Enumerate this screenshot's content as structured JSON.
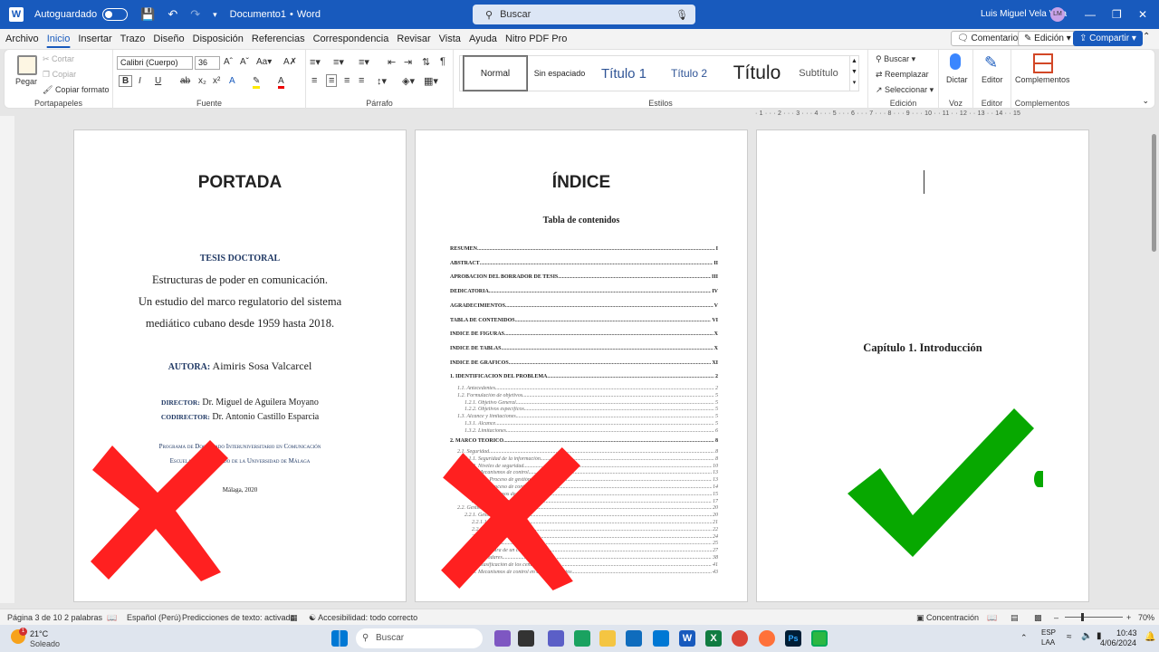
{
  "titlebar": {
    "autosave_label": "Autoguardado",
    "doc_name": "Documento1",
    "separator": "•",
    "app_name": "Word",
    "search_placeholder": "Buscar",
    "user_name": "Luis Miguel Vela Vela",
    "user_initials": "LM"
  },
  "menu": {
    "tabs": [
      "Archivo",
      "Inicio",
      "Insertar",
      "Trazo",
      "Diseño",
      "Disposición",
      "Referencias",
      "Correspondencia",
      "Revisar",
      "Vista",
      "Ayuda",
      "Nitro PDF Pro"
    ],
    "active_tab": "Inicio",
    "comments_label": "Comentarios",
    "edit_label": "Edición",
    "share_label": "Compartir"
  },
  "ribbon": {
    "clipboard": {
      "paste": "Pegar",
      "cut": "Cortar",
      "copy": "Copiar",
      "format_painter": "Copiar formato",
      "label": "Portapapeles"
    },
    "font": {
      "name": "Calibri (Cuerpo)",
      "size": "36",
      "label": "Fuente"
    },
    "paragraph": {
      "label": "Párrafo"
    },
    "styles": {
      "items": [
        "Normal",
        "Sin espaciado",
        "Título 1",
        "Título 2",
        "Título",
        "Subtítulo"
      ],
      "label": "Estilos"
    },
    "editing": {
      "find": "Buscar",
      "replace": "Reemplazar",
      "select": "Seleccionar",
      "label": "Edición"
    },
    "voice": {
      "dictate": "Dictar",
      "label": "Voz"
    },
    "editor": {
      "button": "Editor",
      "label": "Editor"
    },
    "addins": {
      "button": "Complementos",
      "label": "Complementos"
    }
  },
  "ruler_text": "· 1 · · · 2 · · · 3 · · · 4 · · · 5 · · · 6 · · · 7 · · · 8 · · · 9 · · · 10 · · 11 · · 12 · · 13 · · 14 · · 15",
  "page1": {
    "heading": "PORTADA",
    "label": "TESIS DOCTORAL",
    "line1": "Estructuras de poder en comunicación.",
    "line2": "Un estudio del marco regulatorio del sistema",
    "line3": "mediático cubano desde 1959 hasta 2018.",
    "author_label": "AUTORA:",
    "author": "Aimiris Sosa Valcarcel",
    "director_label": "DIRECTOR:",
    "director": "Dr. Miguel de Aguilera Moyano",
    "codirector_label": "CODIRECTOR:",
    "codirector": "Dr. Antonio Castillo Esparcia",
    "program": "Programa de Doctorado Interuniversitario en Comunicación",
    "school": "Escuela de Doctorado de la Universidad de Málaga",
    "place_date": "Málaga, 2020"
  },
  "page2": {
    "heading": "ÍNDICE",
    "subtitle": "Tabla de contenidos",
    "toc": [
      {
        "t": "RESUMEN",
        "p": "I"
      },
      {
        "t": "ABSTRACT",
        "p": "II"
      },
      {
        "t": "APROBACIÓN DEL BORRADOR DE TESIS",
        "p": "III"
      },
      {
        "t": "DEDICATORIA",
        "p": "IV"
      },
      {
        "t": "AGRADECIMIENTOS",
        "p": "V"
      },
      {
        "t": "TABLA DE CONTENIDOS",
        "p": "VI"
      },
      {
        "t": "ÍNDICE DE FIGURAS",
        "p": "X"
      },
      {
        "t": "ÍNDICE DE TABLAS",
        "p": "X"
      },
      {
        "t": "ÍNDICE DE GRÁFICOS",
        "p": "XI"
      },
      {
        "t": "1.    IDENTIFICACIÓN DEL PROBLEMA",
        "p": "2"
      }
    ],
    "toc_sub1": [
      {
        "t": "1.1.    Antecedentes",
        "p": "2"
      },
      {
        "t": "1.2.    Formulación de objetivos",
        "p": "5"
      },
      {
        "t": "1.2.1.    Objetivo General",
        "p": "5"
      },
      {
        "t": "1.2.2.    Objetivos específicos",
        "p": "5"
      },
      {
        "t": "1.3.    Alcance y limitaciones",
        "p": "5"
      },
      {
        "t": "1.3.1.    Alcance",
        "p": "5"
      },
      {
        "t": "1.3.2.    Limitaciones",
        "p": "6"
      }
    ],
    "toc_main2": {
      "t": "2.    MARCO TEÓRICO",
      "p": "8"
    },
    "toc_sub2": [
      {
        "t": "2.1.    Seguridad",
        "p": "8"
      },
      {
        "t": "2.1.1.    Seguridad de la información",
        "p": "8"
      },
      {
        "t": "2.1.2.    Niveles de seguridad",
        "p": "10"
      },
      {
        "t": "2.1.3.    Mecanismos de control",
        "p": "13"
      },
      {
        "t": "2.1.3.1.    Proceso de gestión",
        "p": "13"
      },
      {
        "t": "2.1.3.2.    Proceso de control",
        "p": "14"
      },
      {
        "t": "2.1.3.3.    Procesos de revisión",
        "p": "15"
      },
      {
        "t": "2.1.3.4.    Procesos",
        "p": "17"
      },
      {
        "t": "2.2.    Gestión de la información",
        "p": "20"
      },
      {
        "t": "2.2.1.    Gestión",
        "p": "20"
      },
      {
        "t": "2.2.1.1.    Etapas",
        "p": "21"
      },
      {
        "t": "2.2.1.2.    Recursos",
        "p": "22"
      },
      {
        "t": "2.2.1.3.    Registro en tiempo",
        "p": "24"
      },
      {
        "t": "2.2.1.4.    Datos",
        "p": "25"
      },
      {
        "t": "2.2.2.    Estructura de un centro de datos",
        "p": "27"
      },
      {
        "t": "2.2.3.    Estándares",
        "p": "38"
      },
      {
        "t": "2.2.4.    Clasificación de los centros de datos",
        "p": "41"
      },
      {
        "t": "2.2.5.    Mecanismos de control en centros de datos",
        "p": "43"
      }
    ]
  },
  "page3": {
    "chapter": "Capítulo 1.  Introducción"
  },
  "status": {
    "page": "Página 3 de 10",
    "words": "2 palabras",
    "language": "Español (Perú)",
    "predictions": "Predicciones de texto: activado",
    "accessibility": "Accesibilidad: todo correcto",
    "focus": "Concentración",
    "zoom": "70%"
  },
  "taskbar": {
    "weather_temp": "21°C",
    "weather_desc": "Soleado",
    "search_placeholder": "Buscar",
    "lang_top": "ESP",
    "lang_bottom": "LAA",
    "time": "10:43",
    "date": "4/06/2024",
    "notification_count": "1"
  },
  "colors": {
    "accent": "#185abd",
    "red_x": "#ff2020",
    "green_check": "#07a800",
    "navy_text": "#1f3864"
  },
  "icons": {
    "x_mark": "cross-icon",
    "check_mark": "checkmark-icon"
  }
}
